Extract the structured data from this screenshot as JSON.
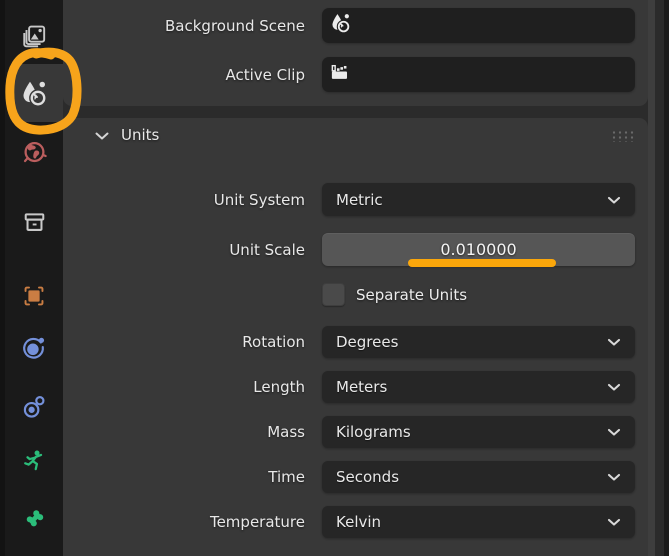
{
  "app": "Blender - Properties Editor (Scene Properties)",
  "sidebar": {
    "tabs": [
      {
        "id": "view-layer",
        "icon": "view-layer-icon",
        "active": false
      },
      {
        "id": "scene",
        "icon": "scene-icon",
        "active": true
      },
      {
        "id": "world",
        "icon": "world-icon",
        "active": false
      },
      {
        "id": "collection",
        "icon": "collection-box-icon",
        "active": false
      },
      {
        "id": "object",
        "icon": "object-icon",
        "active": false
      },
      {
        "id": "physics",
        "icon": "physics-icon",
        "active": false
      },
      {
        "id": "constraints",
        "icon": "constraints-icon",
        "active": false
      },
      {
        "id": "object-data",
        "icon": "armature-icon",
        "active": false
      },
      {
        "id": "bone",
        "icon": "bone-icon",
        "active": false
      }
    ]
  },
  "scene_panel": {
    "rows": [
      {
        "label": "Background Scene",
        "value": "",
        "icon": "scene-icon"
      },
      {
        "label": "Active Clip",
        "value": "",
        "icon": "movie-clip-icon"
      }
    ]
  },
  "units_panel": {
    "title": "Units",
    "header_icons": [
      "chevron-down-icon",
      "drag-grip-icon"
    ],
    "rows": {
      "unit_system": {
        "label": "Unit System",
        "value": "Metric"
      },
      "unit_scale": {
        "label": "Unit Scale",
        "value": "0.010000"
      },
      "separate_units": {
        "label": "Separate Units",
        "checked": false
      },
      "rotation": {
        "label": "Rotation",
        "value": "Degrees"
      },
      "length": {
        "label": "Length",
        "value": "Meters"
      },
      "mass": {
        "label": "Mass",
        "value": "Kilograms"
      },
      "time": {
        "label": "Time",
        "value": "Seconds"
      },
      "temperature": {
        "label": "Temperature",
        "value": "Kelvin"
      }
    }
  },
  "annotations": {
    "color": "#f7a41b",
    "circle_target": "scene-properties-tab",
    "underline_target": "unit-scale-value"
  },
  "colors": {
    "panel_bg": "#383838",
    "editor_gap_bg": "#2b2b2b",
    "tabbar_bg": "#1a1a1a",
    "field_dark": "#1f1f1f",
    "dropdown_bg": "#262626",
    "number_field_bg": "#565656",
    "text": "#e8e8e8",
    "world_icon": "#bb5e5e",
    "object_icon": "#ca7d43",
    "physics_icon": "#7490da",
    "armature_icon": "#2bbd7a",
    "annotation_orange": "#f7a41b"
  }
}
